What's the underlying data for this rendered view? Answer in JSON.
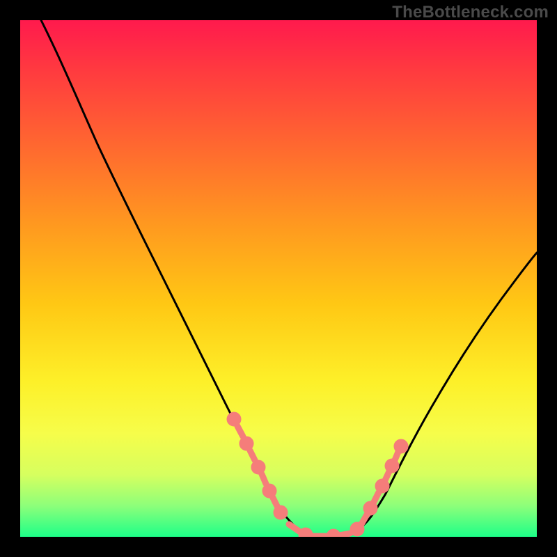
{
  "watermark": "TheBottleneck.com",
  "chart_data": {
    "type": "line",
    "title": "",
    "xlabel": "",
    "ylabel": "",
    "xlim": [
      0,
      100
    ],
    "ylim": [
      0,
      100
    ],
    "grid": false,
    "legend": false,
    "background_gradient": {
      "top": "#ff1a4d",
      "upper_mid": "#ff9a1f",
      "mid": "#fdf029",
      "lower_mid": "#d6ff5f",
      "bottom": "#1dff88"
    },
    "series": [
      {
        "name": "bottleneck-curve",
        "color": "#000000",
        "x": [
          4,
          10,
          15,
          20,
          25,
          30,
          35,
          40,
          45,
          49,
          52,
          55,
          58,
          62,
          66,
          70,
          75,
          80,
          85,
          90,
          95,
          100
        ],
        "values": [
          100,
          87,
          76,
          66,
          56,
          47,
          38,
          29,
          20,
          11,
          6,
          2,
          0,
          0,
          2,
          7,
          14,
          22,
          31,
          40,
          48,
          55
        ]
      }
    ],
    "markers": {
      "name": "highlighted-points",
      "color": "#f57d7a",
      "style": "dots-and-dashes",
      "x": [
        41,
        43,
        45,
        47,
        49,
        51,
        55,
        58,
        61,
        64,
        66,
        68,
        69,
        70,
        71,
        72
      ],
      "values": [
        27,
        23,
        20,
        16,
        11,
        8,
        2,
        0,
        0,
        1,
        2,
        4,
        6,
        8,
        10,
        12
      ]
    }
  }
}
